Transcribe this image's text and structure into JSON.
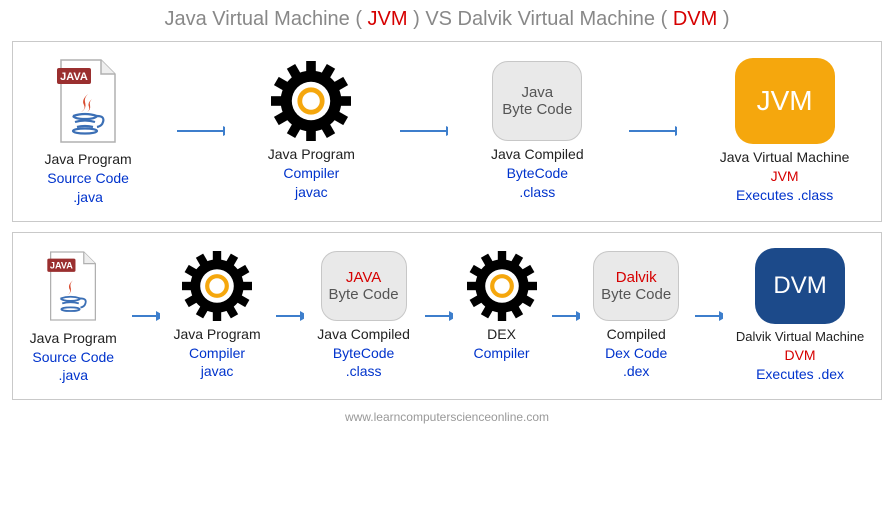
{
  "title": {
    "part1": "Java Virtual Machine ( ",
    "jvm": "JVM",
    "part2": " )   VS  Dalvik Virtual Machine ( ",
    "dvm": "DVM",
    "part3": " )"
  },
  "jvm_flow": {
    "step1": {
      "line1": "Java Program",
      "line2": "Source Code",
      "line3": ".java"
    },
    "step2": {
      "line1": "Java Program",
      "line2": "Compiler",
      "line3": "javac"
    },
    "step3_box": {
      "line1": "Java",
      "line2": "Byte Code"
    },
    "step3": {
      "line1": "Java Compiled",
      "line2": "ByteCode",
      "line3": ".class"
    },
    "step4_box": "JVM",
    "step4": {
      "line1": "Java Virtual Machine",
      "line2": "JVM",
      "line3": "Executes  .class"
    }
  },
  "dvm_flow": {
    "step1": {
      "line1": "Java Program",
      "line2": "Source Code",
      "line3": ".java"
    },
    "step2": {
      "line1": "Java Program",
      "line2": "Compiler",
      "line3": "javac"
    },
    "step3_box": {
      "line1": "JAVA",
      "line2": "Byte Code"
    },
    "step3": {
      "line1": "Java Compiled",
      "line2": "ByteCode",
      "line3": ".class"
    },
    "step4": {
      "line1": "DEX",
      "line2": "Compiler"
    },
    "step5_box": {
      "line1": "Dalvik",
      "line2": "Byte Code"
    },
    "step5": {
      "line1": "Compiled",
      "line2": "Dex Code",
      "line3": ".dex"
    },
    "step6_box": "DVM",
    "step6": {
      "line1": "Dalvik Virtual Machine",
      "line2": "DVM",
      "line3": "Executes  .dex"
    }
  },
  "footer": "www.learncomputerscienceonline.com"
}
